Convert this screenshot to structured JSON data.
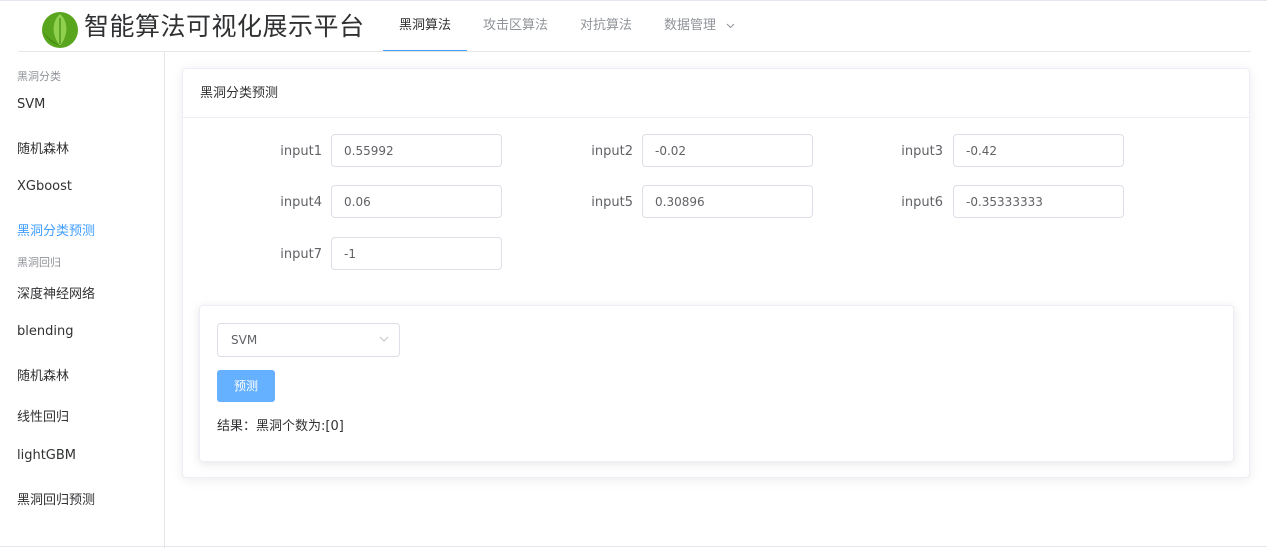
{
  "header": {
    "app_title": "智能算法可视化展示平台",
    "nav": [
      {
        "label": "黑洞算法",
        "active": true
      },
      {
        "label": "攻击区算法",
        "active": false
      },
      {
        "label": "对抗算法",
        "active": false
      },
      {
        "label": "数据管理",
        "active": false,
        "has_dropdown": true
      }
    ]
  },
  "sidebar": {
    "group1_title": "黑洞分类",
    "group1_items": [
      "SVM",
      "随机森林",
      "XGboost",
      "黑洞分类预测"
    ],
    "group2_title": "黑洞回归",
    "group2_items": [
      "深度神经网络",
      "blending",
      "随机森林",
      "线性回归",
      "lightGBM",
      "黑洞回归预测"
    ],
    "active_item": "黑洞分类预测"
  },
  "main": {
    "card_title": "黑洞分类预测",
    "fields": [
      {
        "label": "input1",
        "value": "0.55992"
      },
      {
        "label": "input2",
        "value": "-0.02"
      },
      {
        "label": "input3",
        "value": "-0.42"
      },
      {
        "label": "input4",
        "value": "0.06"
      },
      {
        "label": "input5",
        "value": "0.30896"
      },
      {
        "label": "input6",
        "value": "-0.35333333"
      },
      {
        "label": "input7",
        "value": "-1"
      }
    ],
    "model_select": "SVM",
    "predict_label": "预测",
    "result_text": "结果：黑洞个数为:[0]"
  },
  "colors": {
    "accent": "#409eff",
    "button": "#66b1ff",
    "logo_green": "#58a81f"
  },
  "icons": [
    "leaf-logo-icon",
    "chevron-down-icon"
  ]
}
